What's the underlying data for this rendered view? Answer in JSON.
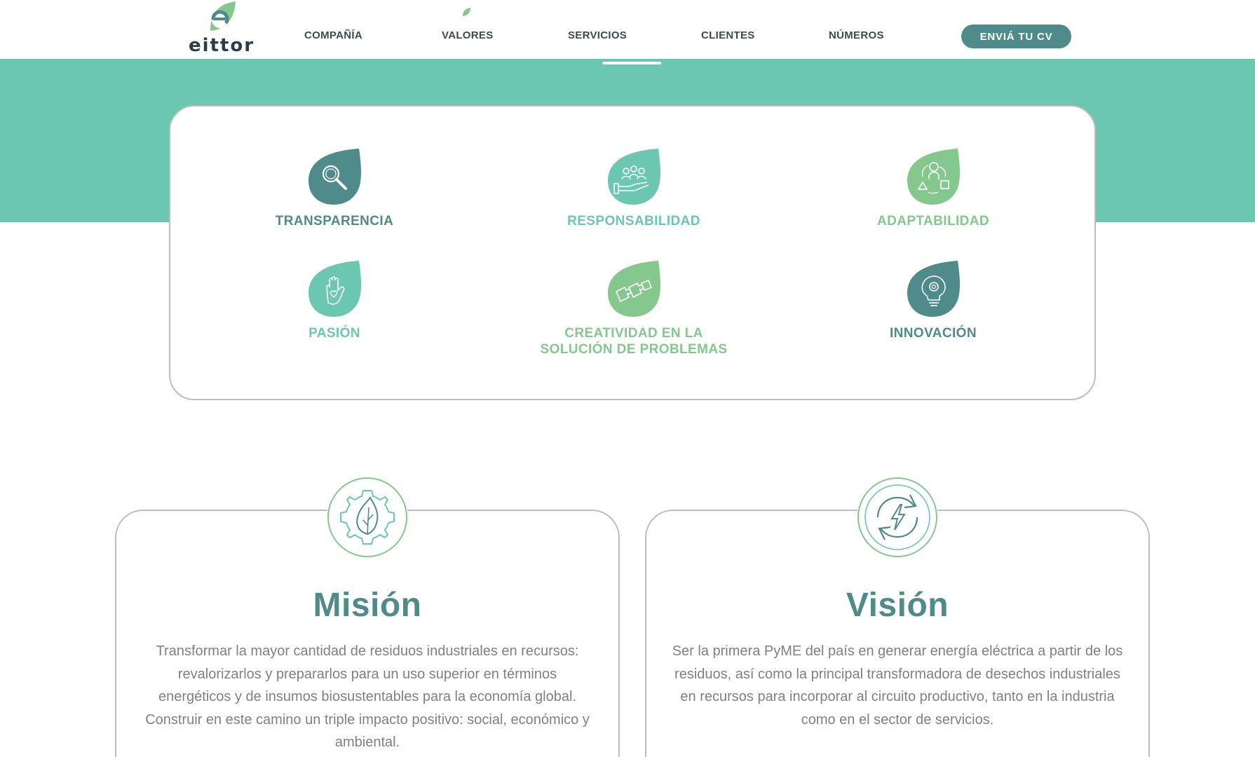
{
  "brand": {
    "name": "eittor"
  },
  "nav": {
    "items": [
      {
        "label": "COMPAÑÍA"
      },
      {
        "label": "VALORES"
      },
      {
        "label": "SERVICIOS"
      },
      {
        "label": "CLIENTES"
      },
      {
        "label": "NÚMEROS"
      }
    ],
    "cta_label": "ENVIÁ TU CV"
  },
  "values": [
    {
      "label": "TRANSPARENCIA",
      "icon": "magnifier-icon",
      "color": "#4f8b8a"
    },
    {
      "label": "RESPONSABILIDAD",
      "icon": "people-hands-icon",
      "color": "#6cc7b0"
    },
    {
      "label": "ADAPTABILIDAD",
      "icon": "shapes-cycle-icon",
      "color": "#85c88e"
    },
    {
      "label": "PASIÓN",
      "icon": "hand-heart-icon",
      "color": "#6cc7b0"
    },
    {
      "label": "CREATIVIDAD EN LA SOLUCIÓN DE PROBLEMAS",
      "label_line1": "CREATIVIDAD EN LA",
      "label_line2": "SOLUCIÓN DE PROBLEMAS",
      "icon": "puzzle-icon",
      "color": "#85c88e"
    },
    {
      "label": "INNOVACIÓN",
      "icon": "lightbulb-gear-icon",
      "color": "#4f8b8a"
    }
  ],
  "mission": {
    "title": "Misión",
    "text_lines": [
      "Transformar la mayor cantidad de residuos industriales en recursos:",
      "revalorizarlos y prepararlos para un uso superior en términos",
      "energéticos y de insumos biosustentables para la economía global.",
      "Construir en este camino un triple impacto positivo: social, económico y",
      "ambiental."
    ],
    "icon": "leaf-gear-icon"
  },
  "vision": {
    "title": "Visión",
    "text_lines": [
      "Ser la primera PyME del país en generar energía eléctrica a partir de los",
      "residuos, así como la principal transformadora de desechos industriales",
      "en recursos para incorporar al circuito productivo, tanto en la industria",
      "como en el sector de servicios."
    ],
    "icon": "recycle-energy-icon"
  },
  "colors": {
    "teal_dark": "#4f8b8a",
    "teal_light": "#6cc7b0",
    "green": "#85c88e",
    "text_gray": "#808080"
  }
}
